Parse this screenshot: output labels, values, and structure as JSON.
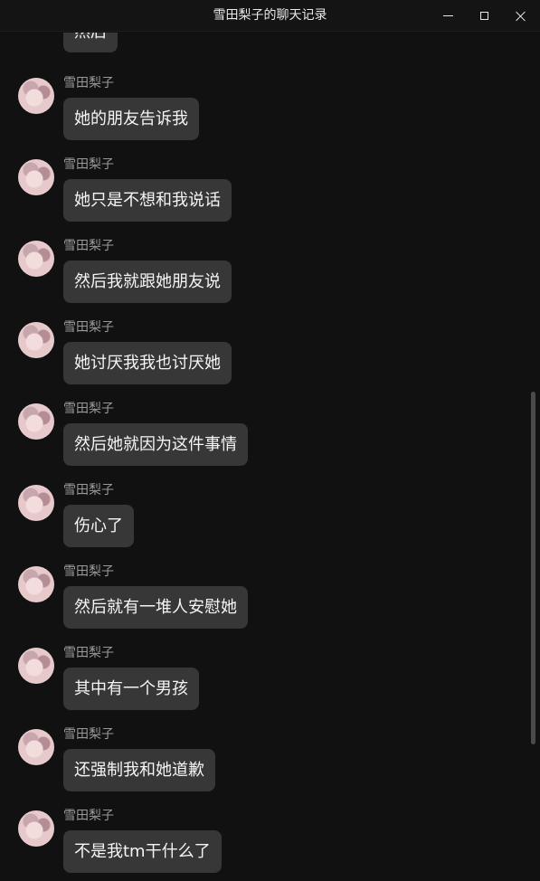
{
  "window": {
    "title": "雪田梨子的聊天记录",
    "controls": [
      "minimize",
      "maximize",
      "close"
    ]
  },
  "chat": {
    "sender": "雪田梨子",
    "messages": [
      {
        "sender": "",
        "text": "然后"
      },
      {
        "sender": "雪田梨子",
        "text": "她的朋友告诉我"
      },
      {
        "sender": "雪田梨子",
        "text": "她只是不想和我说话"
      },
      {
        "sender": "雪田梨子",
        "text": "然后我就跟她朋友说"
      },
      {
        "sender": "雪田梨子",
        "text": "她讨厌我我也讨厌她"
      },
      {
        "sender": "雪田梨子",
        "text": "然后她就因为这件事情"
      },
      {
        "sender": "雪田梨子",
        "text": "伤心了"
      },
      {
        "sender": "雪田梨子",
        "text": "然后就有一堆人安慰她"
      },
      {
        "sender": "雪田梨子",
        "text": "其中有一个男孩"
      },
      {
        "sender": "雪田梨子",
        "text": "还强制我和她道歉"
      },
      {
        "sender": "雪田梨子",
        "text": "不是我tm干什么了"
      }
    ]
  },
  "colors": {
    "background": "#111111",
    "bubble": "#373737",
    "sender_name": "#9a9a9a",
    "text": "#f5f5f5"
  }
}
